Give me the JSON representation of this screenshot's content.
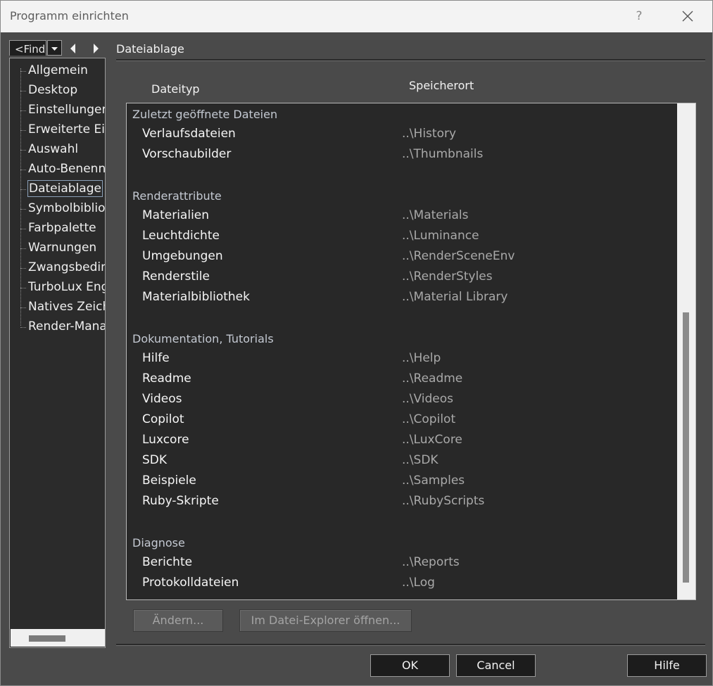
{
  "window": {
    "title": "Programm einrichten",
    "help": "?"
  },
  "search": {
    "value": "<Find"
  },
  "tree": {
    "items": [
      {
        "label": "Allgemein"
      },
      {
        "label": "Desktop"
      },
      {
        "label": "Einstellungen"
      },
      {
        "label": "Erweiterte Eins"
      },
      {
        "label": "Auswahl"
      },
      {
        "label": "Auto-Benennu"
      },
      {
        "label": "Dateiablage"
      },
      {
        "label": "Symbolbibliot"
      },
      {
        "label": "Farbpalette"
      },
      {
        "label": "Warnungen"
      },
      {
        "label": "Zwangsbeding"
      },
      {
        "label": "TurboLux Engi"
      },
      {
        "label": "Natives Zeichn"
      },
      {
        "label": "Render-Manag"
      }
    ],
    "selected": "Dateiablage"
  },
  "section": {
    "title": "Dateiablage"
  },
  "columns": {
    "type": "Dateityp",
    "location": "Speicherort"
  },
  "groups": [
    {
      "label": "Zuletzt geöffnete Dateien",
      "rows": [
        {
          "name": "Verlaufsdateien",
          "path": "..\\History"
        },
        {
          "name": "Vorschaubilder",
          "path": "..\\Thumbnails"
        }
      ]
    },
    {
      "label": "Renderattribute",
      "rows": [
        {
          "name": "Materialien",
          "path": "..\\Materials"
        },
        {
          "name": "Leuchtdichte",
          "path": "..\\Luminance"
        },
        {
          "name": "Umgebungen",
          "path": "..\\RenderSceneEnv"
        },
        {
          "name": "Renderstile",
          "path": "..\\RenderStyles"
        },
        {
          "name": "Materialbibliothek",
          "path": "..\\Material Library"
        }
      ]
    },
    {
      "label": "Dokumentation, Tutorials",
      "rows": [
        {
          "name": "Hilfe",
          "path": "..\\Help"
        },
        {
          "name": "Readme",
          "path": "..\\Readme"
        },
        {
          "name": "Videos",
          "path": "..\\Videos"
        },
        {
          "name": "Copilot",
          "path": "..\\Copilot"
        },
        {
          "name": "Luxcore",
          "path": "..\\LuxCore"
        },
        {
          "name": "SDK",
          "path": "..\\SDK"
        },
        {
          "name": "Beispiele",
          "path": "..\\Samples"
        },
        {
          "name": "Ruby-Skripte",
          "path": "..\\RubyScripts"
        }
      ]
    },
    {
      "label": "Diagnose",
      "rows": [
        {
          "name": "Berichte",
          "path": "..\\Reports"
        },
        {
          "name": "Protokolldateien",
          "path": "..\\Log"
        }
      ]
    }
  ],
  "actions": {
    "change": "Ändern...",
    "explorer": "Im Datei-Explorer öffnen..."
  },
  "footer": {
    "ok": "OK",
    "cancel": "Cancel",
    "help": "Hilfe"
  }
}
